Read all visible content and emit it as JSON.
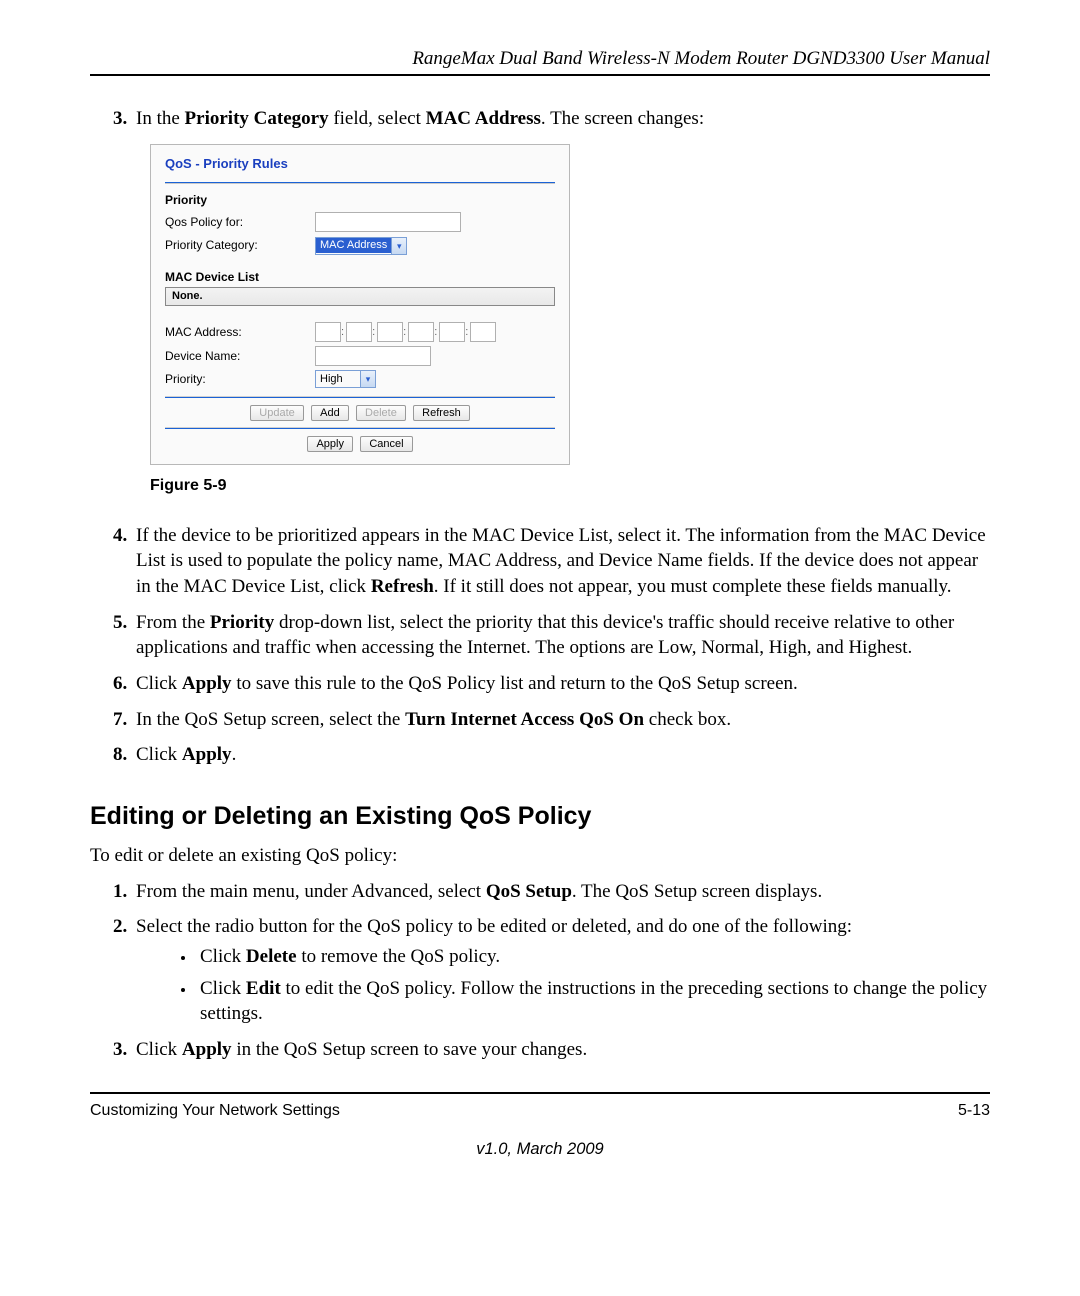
{
  "header": {
    "title": "RangeMax Dual Band Wireless-N Modem Router DGND3300 User Manual"
  },
  "step3": {
    "prefix": "In the ",
    "b1": "Priority Category",
    "mid": " field, select ",
    "b2": "MAC Address",
    "suffix": ". The screen changes:"
  },
  "shot": {
    "title": "QoS - Priority Rules",
    "priority_heading": "Priority",
    "qos_policy_label": "Qos Policy for:",
    "priority_category_label": "Priority Category:",
    "priority_category_value": "MAC Address",
    "mac_device_list_heading": "MAC Device List",
    "mac_device_list_value": "None.",
    "mac_address_label": "MAC Address:",
    "device_name_label": "Device Name:",
    "priority_label": "Priority:",
    "priority_value": "High",
    "btn_update": "Update",
    "btn_add": "Add",
    "btn_delete": "Delete",
    "btn_refresh": "Refresh",
    "btn_apply": "Apply",
    "btn_cancel": "Cancel"
  },
  "figcaption": "Figure 5-9",
  "step4": {
    "p1": "If the device to be prioritized appears in the MAC Device List, select it. The information from the MAC Device List is used to populate the policy name, MAC Address, and Device Name fields. If the device does not appear in the MAC Device List, click ",
    "b1": "Refresh",
    "p2": ". If it still does not appear, you must complete these fields manually."
  },
  "step5": {
    "p1": "From the ",
    "b1": "Priority",
    "p2": " drop-down list, select the priority that this device's traffic should receive relative to other applications and traffic when accessing the Internet. The options are Low, Normal, High, and Highest."
  },
  "step6": {
    "p1": "Click ",
    "b1": "Apply",
    "p2": " to save this rule to the QoS Policy list and return to the QoS Setup screen."
  },
  "step7": {
    "p1": "In the QoS Setup screen, select the ",
    "b1": "Turn Internet Access QoS On",
    "p2": " check box."
  },
  "step8": {
    "p1": "Click ",
    "b1": "Apply",
    "p2": "."
  },
  "subhead": "Editing or Deleting an Existing QoS Policy",
  "intro": "To edit or delete an existing QoS policy:",
  "estep1": {
    "p1": "From the main menu, under Advanced, select ",
    "b1": "QoS Setup",
    "p2": ". The QoS Setup screen displays."
  },
  "estep2": {
    "p1": "Select the radio button for the QoS policy to be edited or deleted, and do one of the following:"
  },
  "sub1": {
    "p1": "Click ",
    "b1": "Delete",
    "p2": " to remove the QoS policy."
  },
  "sub2": {
    "p1": "Click ",
    "b1": "Edit",
    "p2": " to edit the QoS policy. Follow the instructions in the preceding sections to change the policy settings."
  },
  "estep3": {
    "p1": "Click ",
    "b1": "Apply",
    "p2": " in the QoS Setup screen to save your changes."
  },
  "footer": {
    "left": "Customizing Your Network Settings",
    "right": "5-13",
    "version": "v1.0, March 2009"
  }
}
